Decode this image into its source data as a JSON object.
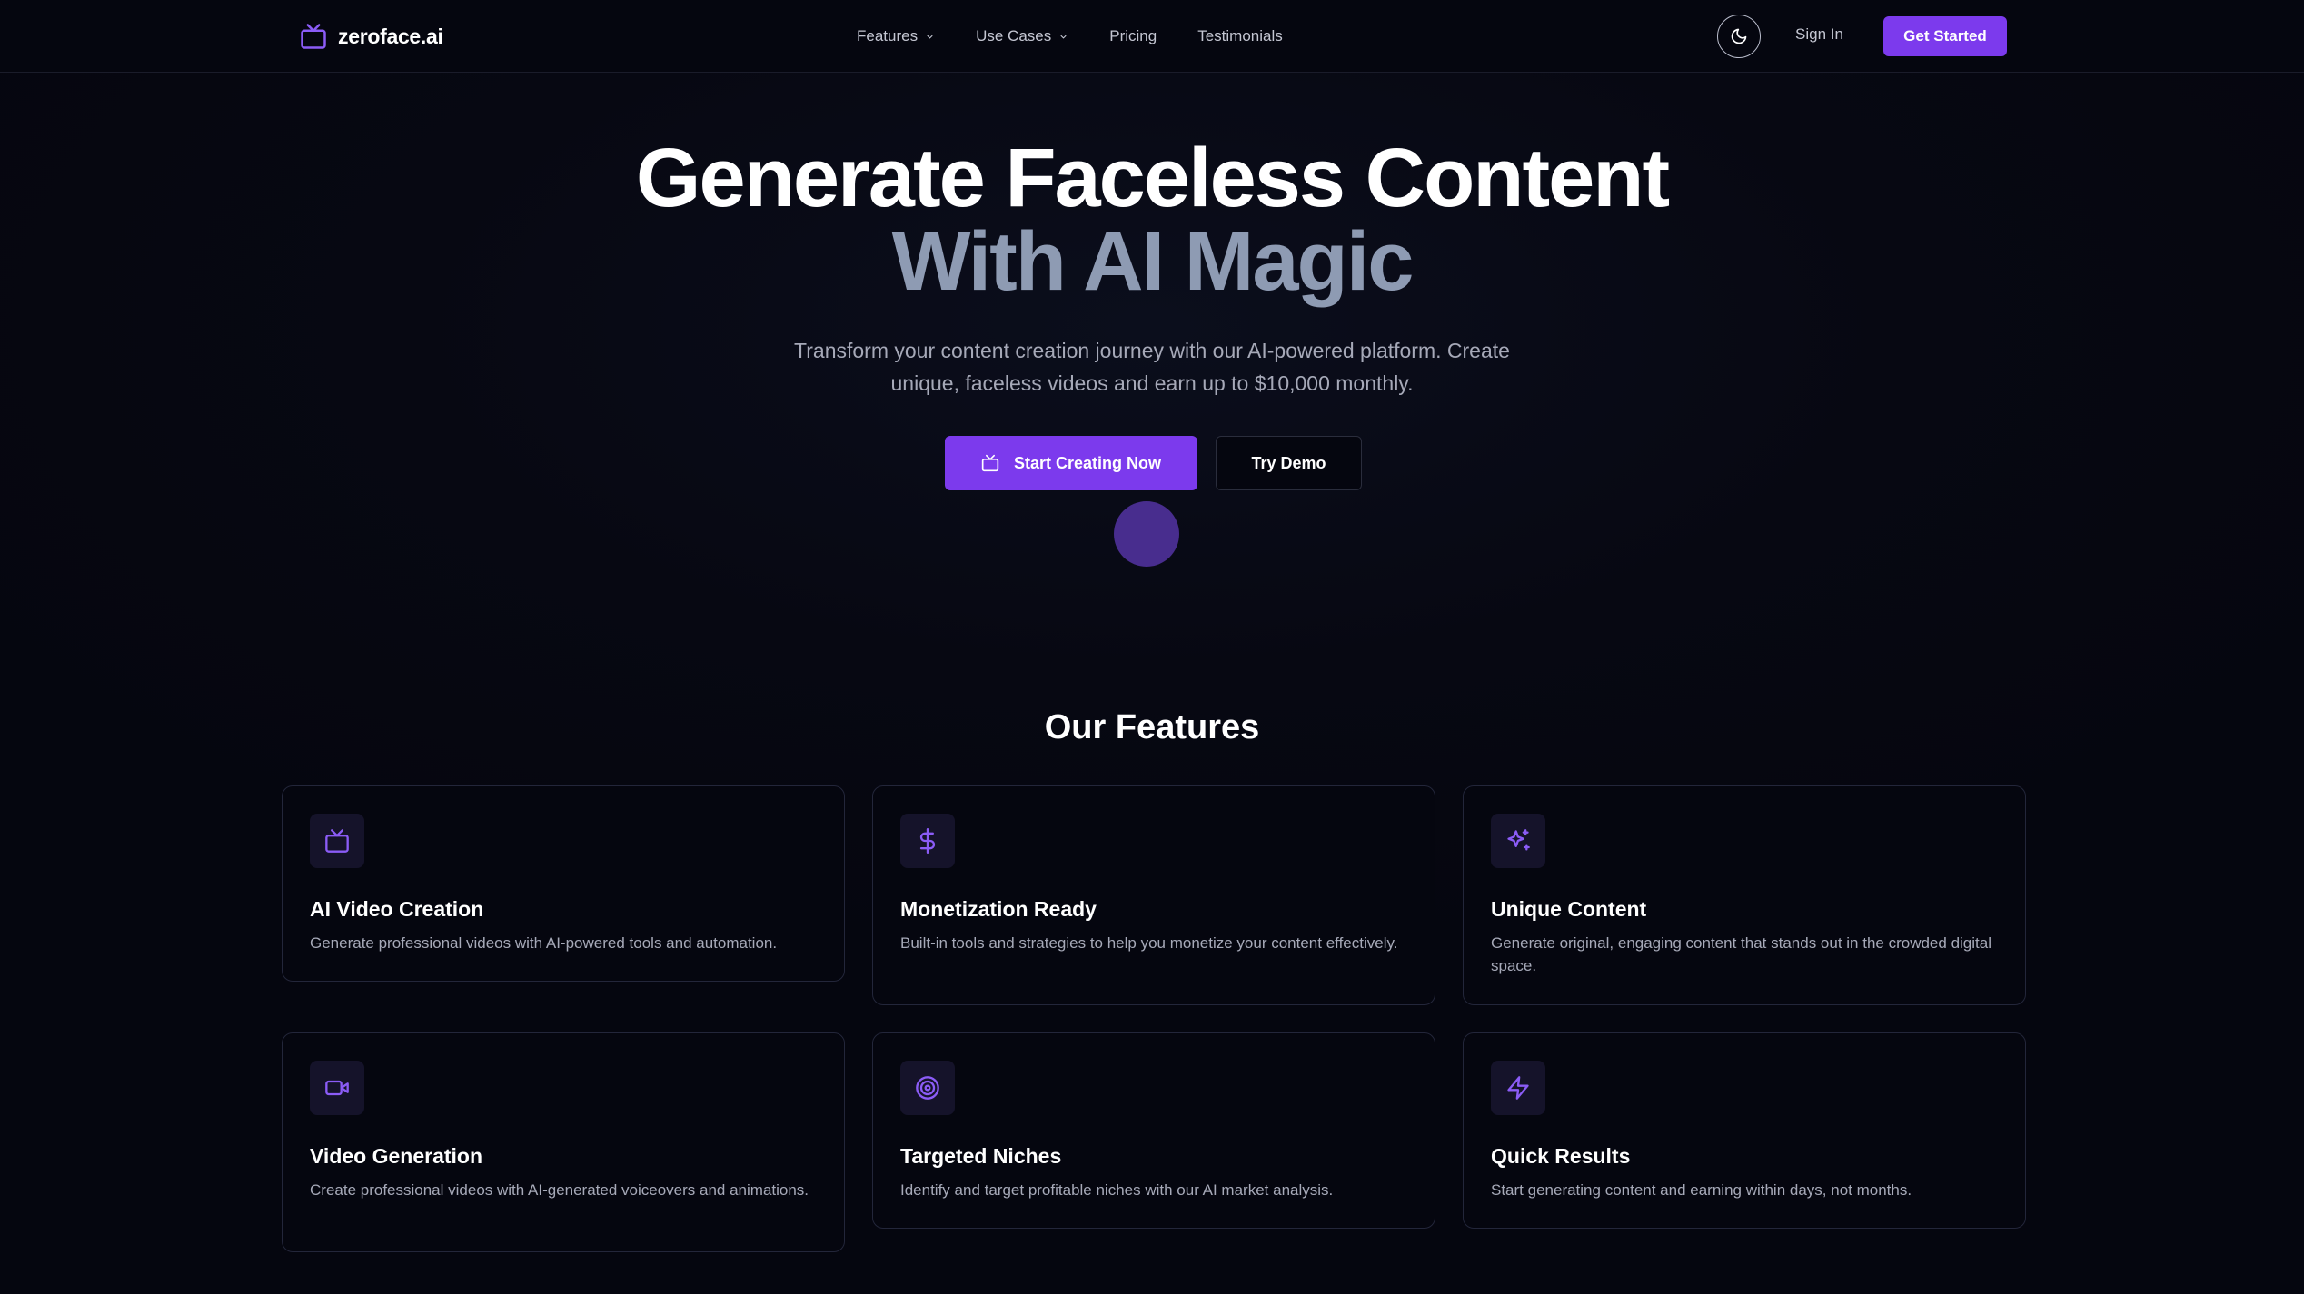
{
  "nav": {
    "logo_text": "zeroface.ai",
    "links": [
      {
        "label": "Features",
        "has_dropdown": true
      },
      {
        "label": "Use Cases",
        "has_dropdown": true
      },
      {
        "label": "Pricing",
        "has_dropdown": false
      },
      {
        "label": "Testimonials",
        "has_dropdown": false
      }
    ],
    "theme_toggle_icon": "moon-icon",
    "signin_label": "Sign In",
    "get_started_label": "Get Started"
  },
  "hero": {
    "title_line1": "Generate Faceless Content",
    "title_line2": "With AI Magic",
    "subtitle_line1": "Transform your content creation journey with our AI-powered platform. Create",
    "subtitle_line2": "unique, faceless videos and earn up to $10,000 monthly.",
    "primary_cta": "Start Creating Now",
    "primary_cta_icon": "tv-icon",
    "secondary_cta": "Try Demo"
  },
  "features": {
    "heading": "Our Features",
    "cards": [
      {
        "icon": "tv-icon",
        "title": "AI Video Creation",
        "desc": "Generate professional videos with AI-powered tools and automation."
      },
      {
        "icon": "dollar-icon",
        "title": "Monetization Ready",
        "desc": "Built-in tools and strategies to help you monetize your content effectively."
      },
      {
        "icon": "sparkles-icon",
        "title": "Unique Content",
        "desc": "Generate original, engaging content that stands out in the crowded digital space."
      },
      {
        "icon": "video-icon",
        "title": "Video Generation",
        "desc": "Create professional videos with AI-generated voiceovers and animations."
      },
      {
        "icon": "target-icon",
        "title": "Targeted Niches",
        "desc": "Identify and target profitable niches with our AI market analysis."
      },
      {
        "icon": "zap-icon",
        "title": "Quick Results",
        "desc": "Start generating content and earning within days, not months."
      }
    ]
  },
  "colors": {
    "background": "#05060f",
    "accent": "#7c3aed",
    "icon_accent": "#8b5cf6",
    "title_secondary": "#8e9bb3",
    "muted_text": "#a6a9b8"
  }
}
